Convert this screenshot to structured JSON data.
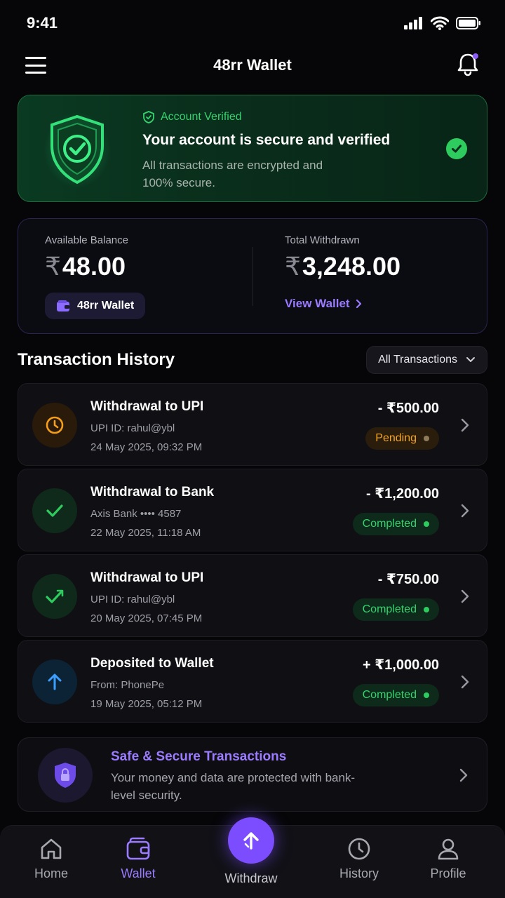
{
  "status_bar": {
    "time": "9:41"
  },
  "header": {
    "title": "48rr Wallet"
  },
  "verification": {
    "tag": "Account Verified",
    "title": "Your account is secure and verified",
    "description": "All transactions are encrypted and 100% secure."
  },
  "balance": {
    "available_label": "Available Balance",
    "currency_symbol": "₹",
    "available_amount": "48.00",
    "wallet_chip": "48rr Wallet",
    "withdrawn_label": "Total Withdrawn",
    "withdrawn_amount": "3,248.00",
    "view_wallet": "View Wallet"
  },
  "history": {
    "title": "Transaction History",
    "filter": "All Transactions",
    "items": [
      {
        "title": "Withdrawal to UPI",
        "detail": "UPI ID: rahul@ybl",
        "date": "24 May 2025, 09:32 PM",
        "amount": "- ₹500.00",
        "status": "Pending",
        "icon": "clock-icon"
      },
      {
        "title": "Withdrawal to Bank",
        "detail": "Axis Bank •••• 4587",
        "date": "22 May 2025, 11:18 AM",
        "amount": "- ₹1,200.00",
        "status": "Completed",
        "icon": "check-icon"
      },
      {
        "title": "Withdrawal to UPI",
        "detail": "UPI ID: rahul@ybl",
        "date": "20 May 2025, 07:45 PM",
        "amount": "- ₹750.00",
        "status": "Completed",
        "icon": "check-arrow-icon"
      },
      {
        "title": "Deposited to Wallet",
        "detail": "From: PhonePe",
        "date": "19 May 2025, 05:12 PM",
        "amount": "+ ₹1,000.00",
        "status": "Completed",
        "icon": "arrow-up-icon"
      }
    ]
  },
  "secure_banner": {
    "title": "Safe & Secure Transactions",
    "description": "Your money and data are protected with bank-level security."
  },
  "nav": {
    "home": "Home",
    "wallet": "Wallet",
    "withdraw": "Withdraw",
    "history": "History",
    "profile": "Profile",
    "active": "wallet"
  },
  "colors": {
    "accent": "#7c4dff",
    "success": "#2ecc5f",
    "pending": "#f5a524",
    "deposit": "#3aa0ff"
  }
}
